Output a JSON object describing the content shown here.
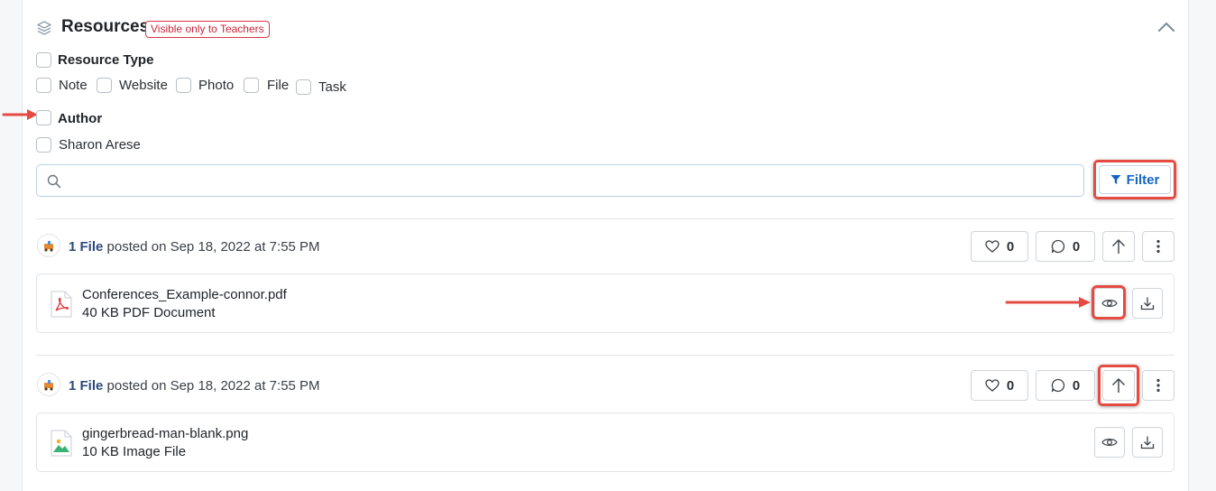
{
  "header": {
    "title": "Resources",
    "badge": "Visible only to Teachers"
  },
  "filters": {
    "resource_type": {
      "label": "Resource Type",
      "options": [
        "Note",
        "Website",
        "Photo",
        "File",
        "Task"
      ]
    },
    "author": {
      "label": "Author",
      "options": [
        "Sharon Arese"
      ]
    },
    "search": {
      "value": "",
      "placeholder": ""
    },
    "filter_button": "Filter"
  },
  "posts": [
    {
      "count_label": "1 File",
      "posted_text": "posted on Sep 18, 2022 at 7:55 PM",
      "likes": "0",
      "comments": "0",
      "file": {
        "name": "Conferences_Example-connor.pdf",
        "description": "40 KB PDF Document",
        "type_icon": "pdf-file-icon"
      }
    },
    {
      "count_label": "1 File",
      "posted_text": "posted on Sep 18, 2022 at 7:55 PM",
      "likes": "0",
      "comments": "0",
      "file": {
        "name": "gingerbread-man-blank.png",
        "description": "10 KB Image File",
        "type_icon": "image-file-icon"
      }
    }
  ],
  "colors": {
    "accent": "#1565c0",
    "highlight": "#e54b42",
    "badge": "#c8283c"
  }
}
